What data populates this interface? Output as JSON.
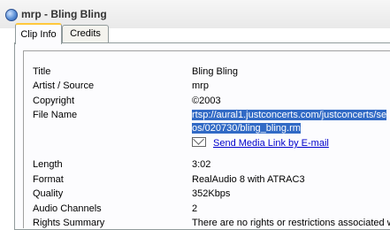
{
  "window": {
    "title": "mrp - Bling Bling"
  },
  "tabs": [
    {
      "label": "Clip Info",
      "active": true
    },
    {
      "label": "Credits",
      "active": false
    }
  ],
  "fields": {
    "title": {
      "label": "Title",
      "value": "Bling Bling"
    },
    "artist": {
      "label": "Artist / Source",
      "value": "mrp"
    },
    "copyright": {
      "label": "Copyright",
      "value": "©2003"
    },
    "file_name": {
      "label": "File Name",
      "line1": "rtsp://aural1.justconcerts.com/justconcerts/se",
      "line2": "os/020730/bling_bling.rm"
    },
    "send_link": "Send Media Link by E-mail",
    "length": {
      "label": "Length",
      "value": "3:02"
    },
    "format": {
      "label": "Format",
      "value": "RealAudio 8 with ATRAC3"
    },
    "quality": {
      "label": "Quality",
      "value": "352Kbps"
    },
    "channels": {
      "label": "Audio Channels",
      "value": "2"
    },
    "rights": {
      "label": "Rights Summary",
      "value": "There are no rights or restrictions associated w"
    }
  },
  "colors": {
    "selection": "#316ac5",
    "link": "#0000cc",
    "active_tab_accent": "#ffc83c"
  },
  "icons": {
    "window": "realplayer-icon",
    "mail": "envelope-icon"
  }
}
